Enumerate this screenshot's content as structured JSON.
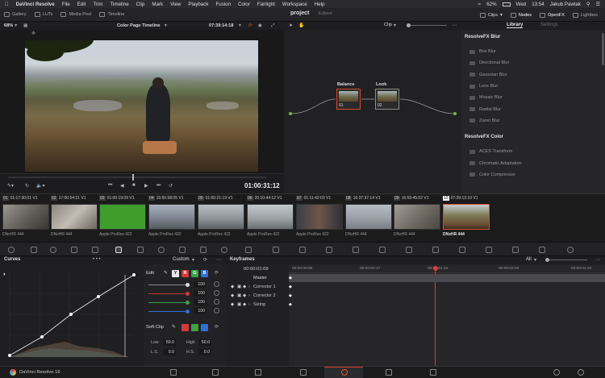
{
  "menubar": {
    "app": "DaVinci Resolve",
    "items": [
      "File",
      "Edit",
      "Trim",
      "Timeline",
      "Clip",
      "Mark",
      "View",
      "Playback",
      "Fusion",
      "Color",
      "Fairlight",
      "Workspace",
      "Help"
    ],
    "battery": "62%",
    "clock": "Wed",
    "time": "13:54",
    "user": "Jakub Pawlak"
  },
  "toolbar": {
    "gallery": "Gallery",
    "luts": "LUTs",
    "media_pool": "Media Pool",
    "timeline": "Timeline",
    "project": "project",
    "status": "Edited",
    "clips": "Clips",
    "nodes": "Nodes",
    "openfx": "OpenFX",
    "lightbox": "Lightbox"
  },
  "viewer": {
    "zoom": "68%",
    "timeline_name": "Color Page Timeline",
    "source_tc": "07:39:14:18",
    "record_tc": "01:00:31:12"
  },
  "nodes": {
    "mode": "Clip",
    "node1_label": "Balance",
    "node1_num": "01",
    "node2_label": "Look",
    "node2_num": "02"
  },
  "library": {
    "tab_library": "Library",
    "tab_settings": "Settings",
    "group1": "ResolveFX Blur",
    "blur_items": [
      "Box Blur",
      "Directional Blur",
      "Gaussian Blur",
      "Lens Blur",
      "Mosaic Blur",
      "Radial Blur",
      "Zoom Blur"
    ],
    "group2": "ResolveFX Color",
    "color_items": [
      "ACES Transform",
      "Chromatic Adaptation",
      "Color Compressor"
    ]
  },
  "clips": [
    {
      "num": "01",
      "tc": "01:17:30:01",
      "track": "V1",
      "codec": "DNxHR 444"
    },
    {
      "num": "02",
      "tc": "17:00:54:21",
      "track": "V1",
      "codec": "DNxHR 444"
    },
    {
      "num": "03",
      "tc": "01:00:19:09",
      "track": "V1",
      "codec": "Apple ProRes 422"
    },
    {
      "num": "04",
      "tc": "15:55:58:05",
      "track": "V1",
      "codec": "Apple ProRes 422"
    },
    {
      "num": "05",
      "tc": "01:00:21:19",
      "track": "V1",
      "codec": "Apple ProRes 422"
    },
    {
      "num": "06",
      "tc": "20:10:44:12",
      "track": "V1",
      "codec": "Apple ProRes 422"
    },
    {
      "num": "07",
      "tc": "01:11:42:03",
      "track": "V1",
      "codec": "Apple ProRes 422"
    },
    {
      "num": "08",
      "tc": "16:37:37:14",
      "track": "V1",
      "codec": "DNxHR 444"
    },
    {
      "num": "09",
      "tc": "16:59:45:02",
      "track": "V1",
      "codec": "DNxHR 444"
    },
    {
      "num": "10",
      "tc": "07:39:13:10",
      "track": "V1",
      "codec": "DNxHR 444"
    }
  ],
  "curves": {
    "title": "Curves",
    "mode": "Custom",
    "edit_label": "Edit",
    "y_label": "Y",
    "r_label": "R",
    "g_label": "G",
    "b_label": "B",
    "values": [
      "100",
      "100",
      "100",
      "100"
    ],
    "soft_clip": "Soft Clip",
    "low_label": "Low",
    "low": "50.0",
    "high_label": "High",
    "high": "50.0",
    "ls_label": "L.S.",
    "ls": "0.0",
    "hs_label": "H.S.",
    "hs": "0.0"
  },
  "keyframes": {
    "title": "Keyframes",
    "filter": "All",
    "current_tc": "00:00:01:09",
    "ruler": [
      "00:00:00:00",
      "00:00:00:17",
      "00:00:01:10",
      "00:00:02:03",
      "00:00:02:20"
    ],
    "master": "Master",
    "rows": [
      "Corrector 1",
      "Corrector 2",
      "Sizing"
    ]
  },
  "footer": {
    "app_label": "DaVinci Resolve 16"
  }
}
